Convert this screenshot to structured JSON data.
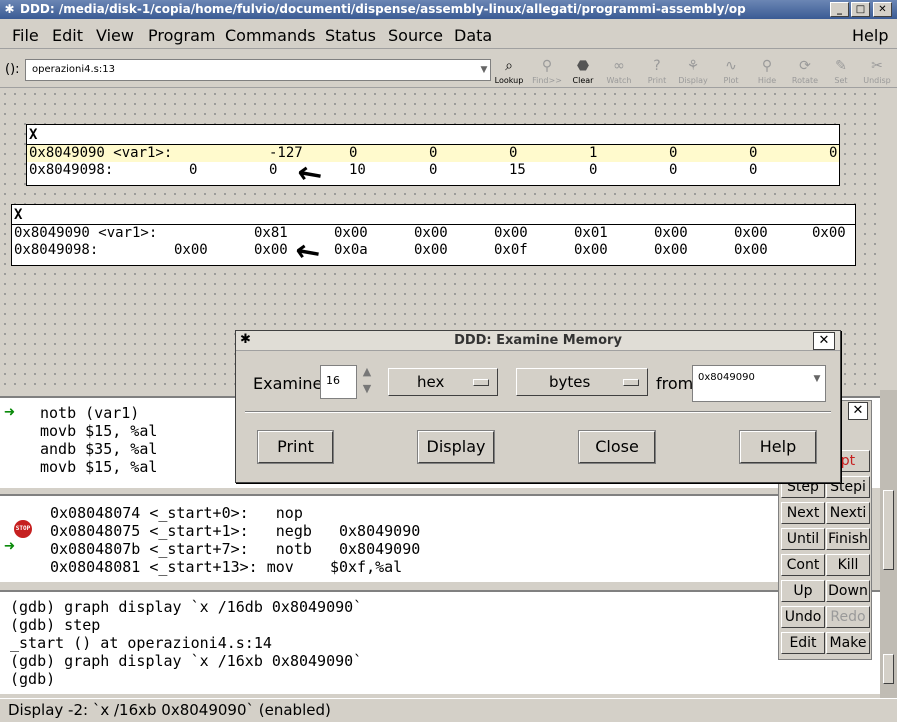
{
  "window": {
    "title": "DDD: /media/disk-1/copia/home/fulvio/documenti/dispense/assembly-linux/allegati/programmi-assembly/op"
  },
  "menu": {
    "items": [
      "File",
      "Edit",
      "View",
      "Program",
      "Commands",
      "Status",
      "Source",
      "Data"
    ],
    "help": "Help"
  },
  "toolbar": {
    "arg_label": "():",
    "arg_value": "operazioni4.s:13",
    "buttons": [
      {
        "label": "Lookup",
        "icon": "lookup-icon",
        "enabled": true
      },
      {
        "label": "Find>>",
        "icon": "find-icon",
        "enabled": false
      },
      {
        "label": "Clear",
        "icon": "stop-icon",
        "enabled": true
      },
      {
        "label": "Watch",
        "icon": "watch-icon",
        "enabled": false
      },
      {
        "label": "Print",
        "icon": "print-icon",
        "enabled": false
      },
      {
        "label": "Display",
        "icon": "display-icon",
        "enabled": false
      },
      {
        "label": "Plot",
        "icon": "plot-icon",
        "enabled": false
      },
      {
        "label": "Hide",
        "icon": "hide-icon",
        "enabled": false
      },
      {
        "label": "Rotate",
        "icon": "rotate-icon",
        "enabled": false
      },
      {
        "label": "Set",
        "icon": "set-icon",
        "enabled": false
      },
      {
        "label": "Undisp",
        "icon": "undisp-icon",
        "enabled": false
      }
    ]
  },
  "displays": [
    {
      "header": "X",
      "rows": [
        {
          "addr": "0x8049090 <var1>:",
          "values": [
            "-127",
            "0",
            "0",
            "0",
            "1",
            "0",
            "0",
            "0"
          ]
        },
        {
          "addr": "0x8049098:",
          "values": [
            "0",
            "0",
            "10",
            "0",
            "15",
            "0",
            "0",
            "0"
          ]
        }
      ]
    },
    {
      "header": "X",
      "rows": [
        {
          "addr": "0x8049090 <var1>:",
          "values": [
            "0x81",
            "0x00",
            "0x00",
            "0x00",
            "0x01",
            "0x00",
            "0x00",
            "0x00"
          ]
        },
        {
          "addr": "0x8049098:",
          "values": [
            "0x00",
            "0x00",
            "0x0a",
            "0x00",
            "0x0f",
            "0x00",
            "0x00",
            "0x00"
          ]
        }
      ]
    }
  ],
  "source": {
    "lines": [
      "notb (var1)",
      "movb $15, %al",
      "andb $35, %al",
      "movb $15, %al"
    ]
  },
  "asm": {
    "lines": [
      "0x08048074 <_start+0>:   nop",
      "0x08048075 <_start+1>:   negb   0x8049090",
      "0x0804807b <_start+7>:   notb   0x8049090",
      "0x08048081 <_start+13>: mov    $0xf,%al"
    ],
    "stop_label": "STOP"
  },
  "console": {
    "lines": [
      "(gdb) graph display `x /16db 0x8049090`",
      "(gdb) step",
      "_start () at operazioni4.s:14",
      "(gdb) graph display `x /16xb 0x8049090`",
      "(gdb)"
    ]
  },
  "status": "Display -2: `x /16xb 0x8049090` (enabled)",
  "commandtool": {
    "partial": "pt",
    "buttons": [
      {
        "label": "Step",
        "enabled": true
      },
      {
        "label": "Stepi",
        "enabled": true
      },
      {
        "label": "Next",
        "enabled": true
      },
      {
        "label": "Nexti",
        "enabled": true
      },
      {
        "label": "Until",
        "enabled": true
      },
      {
        "label": "Finish",
        "enabled": true
      },
      {
        "label": "Cont",
        "enabled": true
      },
      {
        "label": "Kill",
        "enabled": true
      },
      {
        "label": "Up",
        "enabled": true
      },
      {
        "label": "Down",
        "enabled": true
      },
      {
        "label": "Undo",
        "enabled": true
      },
      {
        "label": "Redo",
        "enabled": false
      },
      {
        "label": "Edit",
        "enabled": true
      },
      {
        "label": "Make",
        "enabled": true
      }
    ]
  },
  "dialog": {
    "title": "DDD: Examine Memory",
    "examine_label": "Examine",
    "count": "16",
    "format": "hex",
    "size": "bytes",
    "from_label": "from",
    "address": "0x8049090",
    "buttons": [
      "Print",
      "Display",
      "Close",
      "Help"
    ]
  }
}
